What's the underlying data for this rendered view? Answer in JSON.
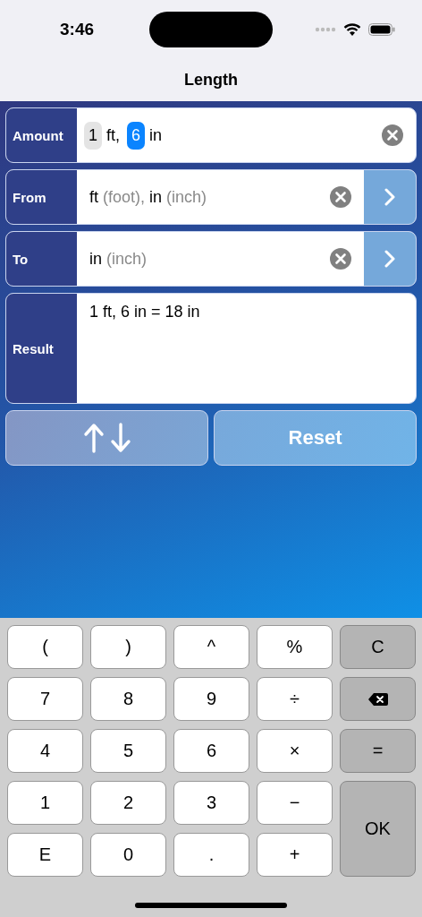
{
  "status_bar": {
    "time": "3:46"
  },
  "nav": {
    "title": "Length"
  },
  "amount": {
    "label": "Amount",
    "parts": [
      {
        "value": "1",
        "unit": "ft,",
        "selected": false
      },
      {
        "value": "6",
        "unit": "in",
        "selected": true
      }
    ]
  },
  "from": {
    "label": "From",
    "units": [
      {
        "symbol": "ft",
        "name": "(foot),"
      },
      {
        "symbol": "in",
        "name": "(inch)"
      }
    ]
  },
  "to": {
    "label": "To",
    "units": [
      {
        "symbol": "in",
        "name": "(inch)"
      }
    ]
  },
  "result": {
    "label": "Result",
    "text": "1 ft, 6 in = 18 in"
  },
  "reset_button": "Reset",
  "keys": [
    {
      "label": "(",
      "kind": "key"
    },
    {
      "label": ")",
      "kind": "key"
    },
    {
      "label": "^",
      "kind": "key"
    },
    {
      "label": "%",
      "kind": "key"
    },
    {
      "label": "C",
      "kind": "function"
    },
    {
      "label": "7",
      "kind": "key"
    },
    {
      "label": "8",
      "kind": "key"
    },
    {
      "label": "9",
      "kind": "key"
    },
    {
      "label": "÷",
      "kind": "key"
    },
    {
      "kind": "backspace"
    },
    {
      "label": "4",
      "kind": "key"
    },
    {
      "label": "5",
      "kind": "key"
    },
    {
      "label": "6",
      "kind": "key"
    },
    {
      "label": "×",
      "kind": "key"
    },
    {
      "label": "=",
      "kind": "function"
    },
    {
      "label": "1",
      "kind": "key"
    },
    {
      "label": "2",
      "kind": "key"
    },
    {
      "label": "3",
      "kind": "key"
    },
    {
      "label": "−",
      "kind": "key"
    },
    {
      "label": "OK",
      "kind": "ok"
    },
    {
      "label": "E",
      "kind": "key"
    },
    {
      "label": "0",
      "kind": "key"
    },
    {
      "label": ".",
      "kind": "key"
    },
    {
      "label": "+",
      "kind": "key"
    }
  ]
}
